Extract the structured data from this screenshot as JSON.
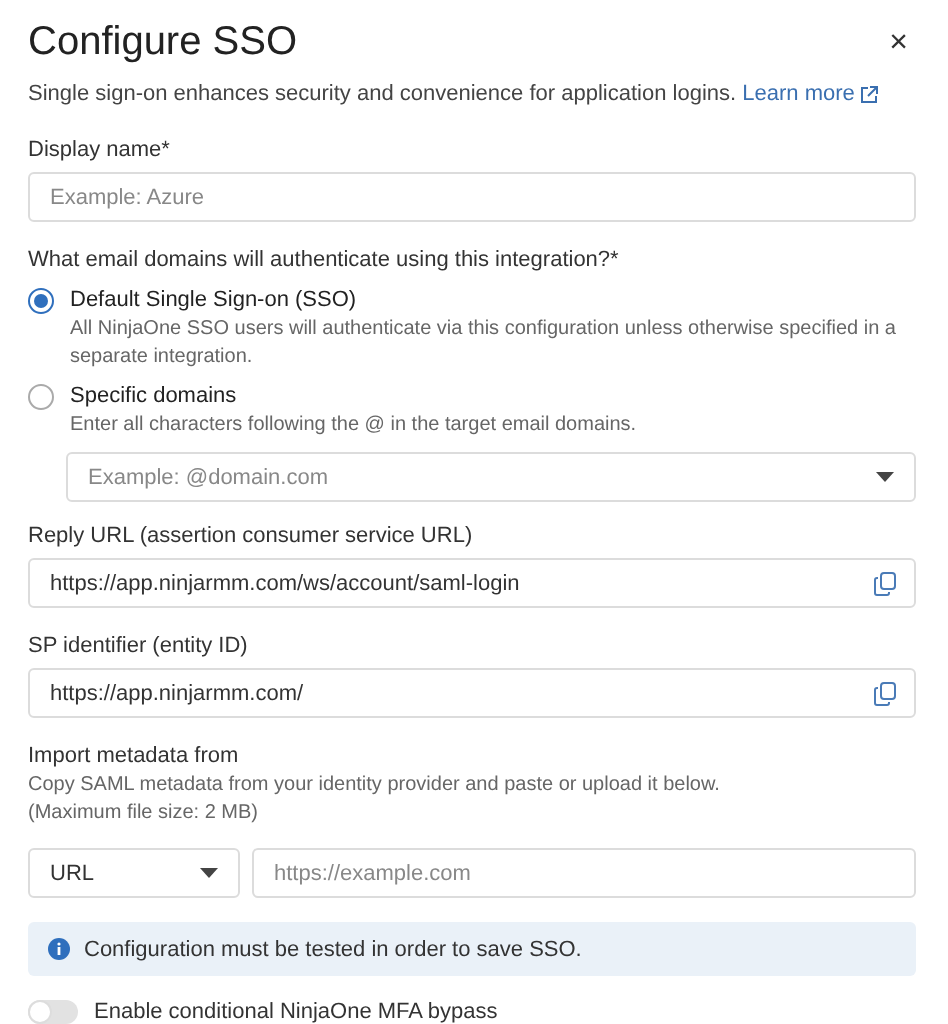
{
  "dialog": {
    "title": "Configure SSO",
    "close": "×",
    "subtitle": "Single sign-on enhances security and convenience for application logins.",
    "learn_more": "Learn more"
  },
  "display_name": {
    "label": "Display name*",
    "placeholder": "Example: Azure"
  },
  "domains": {
    "question": "What email domains will authenticate using this integration?*",
    "options": [
      {
        "label": "Default Single Sign-on (SSO)",
        "description": "All NinjaOne SSO users will authenticate via this configuration unless otherwise specified in a separate integration.",
        "selected": true
      },
      {
        "label": "Specific domains",
        "description": "Enter all characters following the @ in the target email domains.",
        "selected": false
      }
    ],
    "domain_select": {
      "placeholder": "Example: @domain.com"
    }
  },
  "copy_fields": [
    {
      "label": "Reply URL (assertion consumer service URL)",
      "value": "https://app.ninjarmm.com/ws/account/saml-login"
    },
    {
      "label": "SP identifier (entity ID)",
      "value": "https://app.ninjarmm.com/"
    }
  ],
  "import": {
    "label": "Import metadata from",
    "description": "Copy SAML metadata from your identity provider and paste or upload it below.",
    "note": "(Maximum file size: 2 MB)",
    "source": "URL",
    "url_placeholder": "https://example.com"
  },
  "info": "Configuration must be tested in order to save SSO.",
  "mfa_toggle": {
    "label": "Enable conditional NinjaOne MFA bypass",
    "on": false
  }
}
